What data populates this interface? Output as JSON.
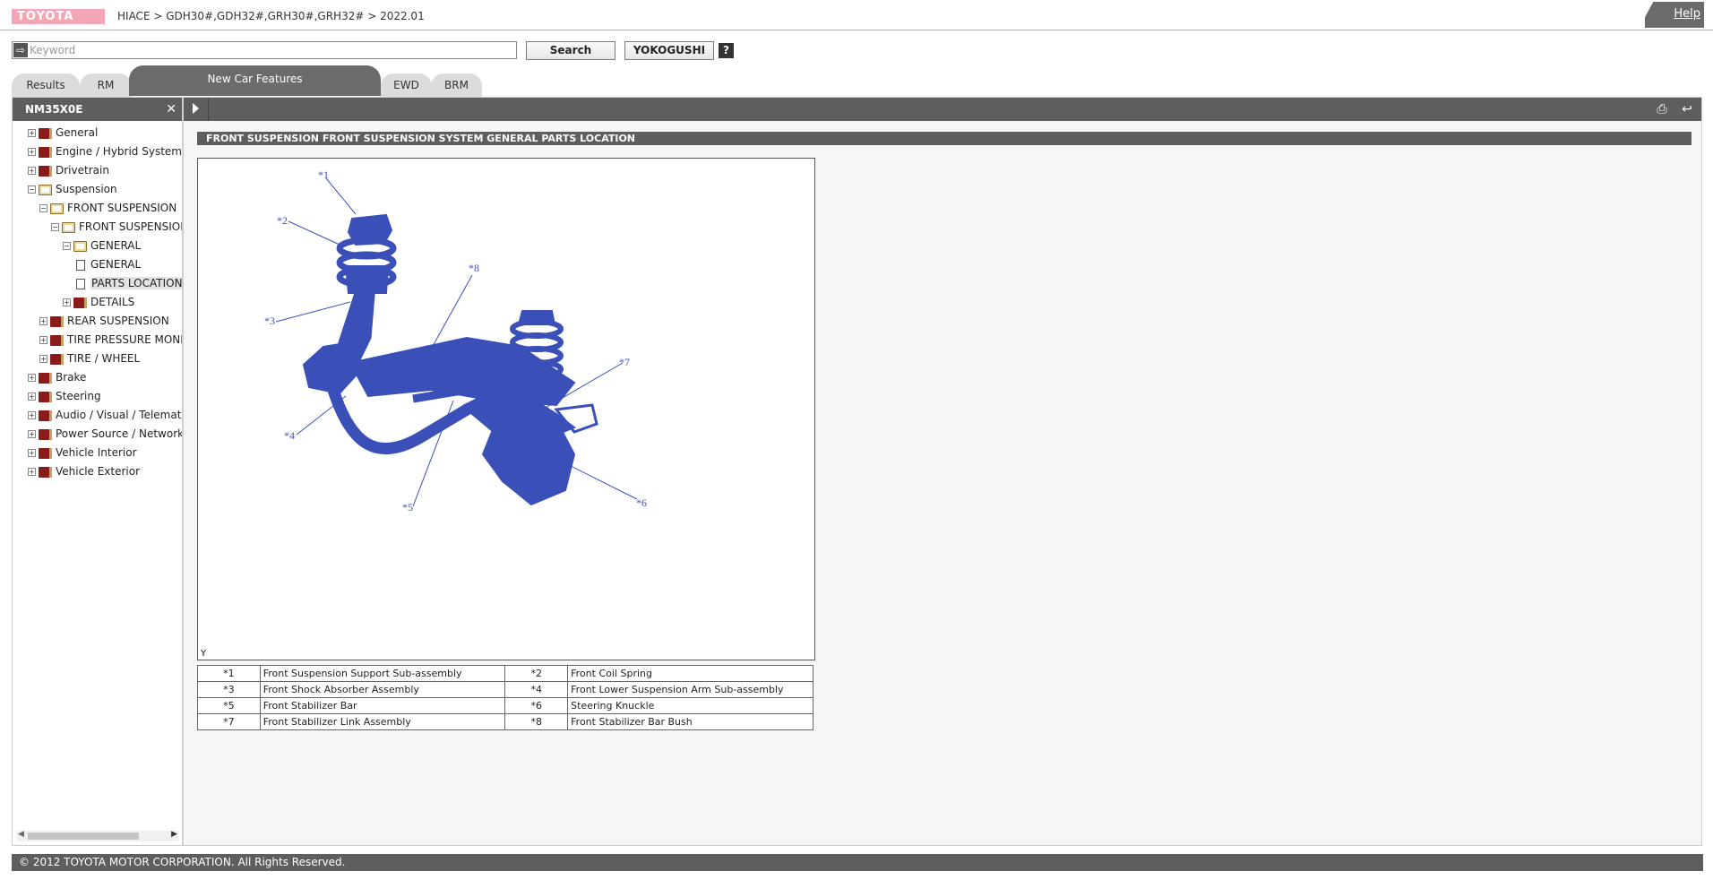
{
  "header": {
    "logo": "TOYOTA",
    "breadcrumb": "HIACE > GDH30#,GDH32#,GRH30#,GRH32# > 2022.01",
    "help": "Help"
  },
  "search": {
    "placeholder": "Keyword",
    "value": "",
    "search_label": "Search",
    "yokogushi_label": "YOKOGUSHI",
    "help_label": "?"
  },
  "tabs": [
    {
      "label": "Results"
    },
    {
      "label": "RM"
    },
    {
      "label": "New Car Features",
      "active": true
    },
    {
      "label": "EWD"
    },
    {
      "label": "BRM"
    }
  ],
  "left_panel": {
    "title": "NM35X0E",
    "close": "✕",
    "tree": [
      {
        "label": "General"
      },
      {
        "label": "Engine / Hybrid System"
      },
      {
        "label": "Drivetrain"
      },
      {
        "label": "Suspension"
      },
      {
        "label": "FRONT SUSPENSION"
      },
      {
        "label": "FRONT SUSPENSION SYSTEM"
      },
      {
        "label": "GENERAL"
      },
      {
        "label": "GENERAL"
      },
      {
        "label": "PARTS LOCATION"
      },
      {
        "label": "DETAILS"
      },
      {
        "label": "REAR SUSPENSION"
      },
      {
        "label": "TIRE PRESSURE MONITORING"
      },
      {
        "label": "TIRE / WHEEL"
      },
      {
        "label": "Brake"
      },
      {
        "label": "Steering"
      },
      {
        "label": "Audio / Visual / Telematics"
      },
      {
        "label": "Power Source / Network"
      },
      {
        "label": "Vehicle Interior"
      },
      {
        "label": "Vehicle Exterior"
      }
    ]
  },
  "document": {
    "title": "FRONT SUSPENSION  FRONT SUSPENSION SYSTEM  GENERAL  PARTS LOCATION",
    "figure_id": "Y",
    "callouts": [
      "*1",
      "*2",
      "*3",
      "*4",
      "*5",
      "*6",
      "*7",
      "*8"
    ],
    "legend": [
      [
        {
          "num": "*1",
          "text": "Front Suspension Support Sub-assembly"
        },
        {
          "num": "*2",
          "text": "Front Coil Spring"
        }
      ],
      [
        {
          "num": "*3",
          "text": "Front Shock Absorber Assembly"
        },
        {
          "num": "*4",
          "text": "Front Lower Suspension Arm Sub-assembly"
        }
      ],
      [
        {
          "num": "*5",
          "text": "Front Stabilizer Bar"
        },
        {
          "num": "*6",
          "text": "Steering Knuckle"
        }
      ],
      [
        {
          "num": "*7",
          "text": "Front Stabilizer Link Assembly"
        },
        {
          "num": "*8",
          "text": "Front Stabilizer Bar Bush"
        }
      ]
    ],
    "figure_color": "#3a4fb8"
  },
  "footer": {
    "copyright": "© 2012 TOYOTA MOTOR CORPORATION. All Rights Reserved."
  }
}
